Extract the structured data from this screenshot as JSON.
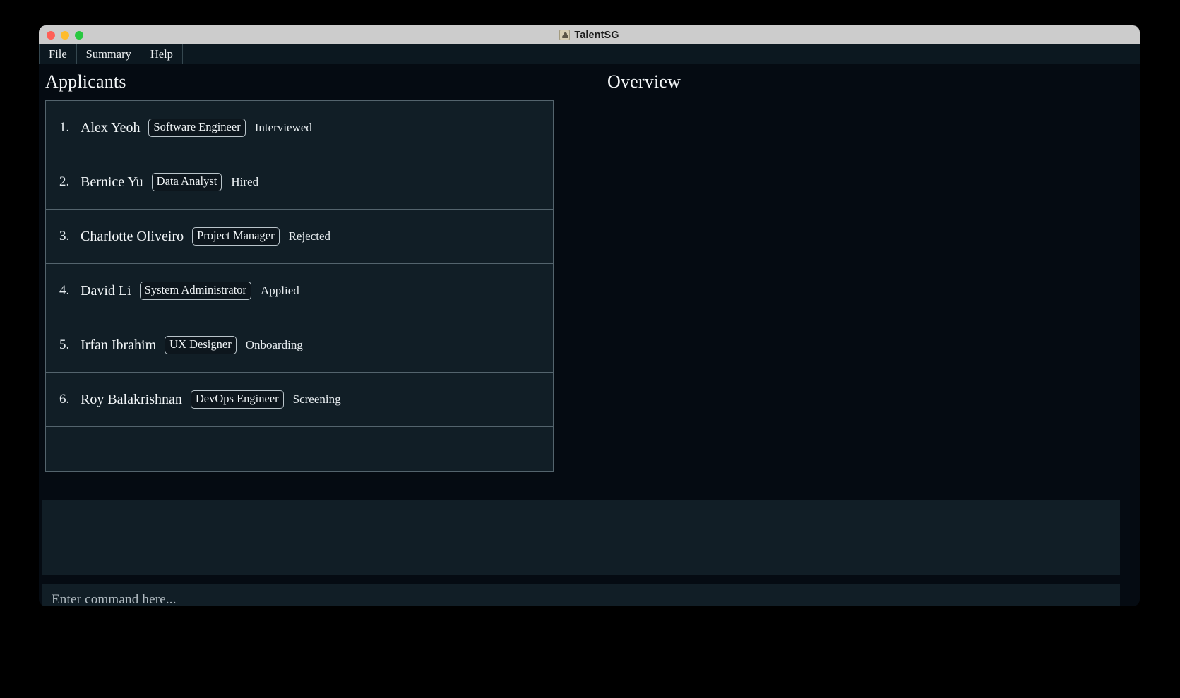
{
  "window": {
    "title": "TalentSG",
    "app_icon": "person-bust-icon",
    "controls": {
      "close": "close-button",
      "minimize": "minimize-button",
      "maximize": "maximize-button"
    }
  },
  "menubar": {
    "items": [
      {
        "label": "File"
      },
      {
        "label": "Summary"
      },
      {
        "label": "Help"
      }
    ]
  },
  "panels": {
    "left_title": "Applicants",
    "right_title": "Overview"
  },
  "applicants": [
    {
      "index": "1.",
      "name": "Alex Yeoh",
      "role": "Software Engineer",
      "status": "Interviewed"
    },
    {
      "index": "2.",
      "name": "Bernice Yu",
      "role": "Data Analyst",
      "status": "Hired"
    },
    {
      "index": "3.",
      "name": "Charlotte Oliveiro",
      "role": "Project Manager",
      "status": "Rejected"
    },
    {
      "index": "4.",
      "name": "David Li",
      "role": "System Administrator",
      "status": "Applied"
    },
    {
      "index": "5.",
      "name": "Irfan Ibrahim",
      "role": "UX Designer",
      "status": "Onboarding"
    },
    {
      "index": "6.",
      "name": "Roy Balakrishnan",
      "role": "DevOps Engineer",
      "status": "Screening"
    }
  ],
  "result_display": {
    "text": ""
  },
  "command": {
    "value": "",
    "placeholder": "Enter command here..."
  },
  "colors": {
    "window_bg": "#050b12",
    "panel_bg": "#111e26",
    "menubar_bg": "#0c1820",
    "titlebar_bg": "#cccccc",
    "border": "#54646d",
    "text": "#f2f6f8",
    "placeholder": "#b2bcc2",
    "accent_underline": "#ffffff"
  }
}
